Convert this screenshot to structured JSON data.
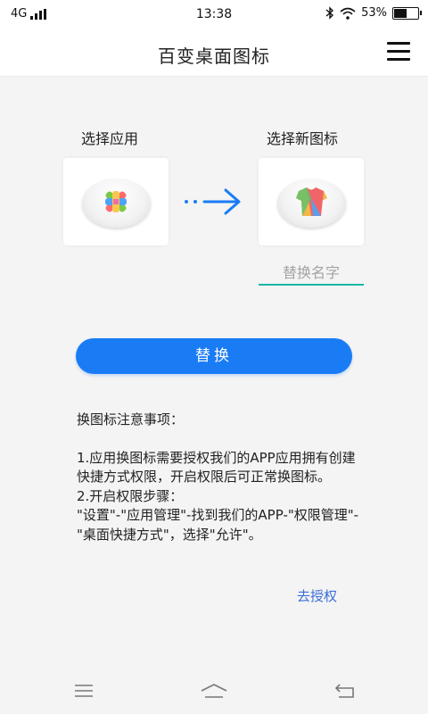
{
  "status_bar": {
    "network": "4G",
    "time": "13:38",
    "battery_percent": "53%",
    "battery_level": 0.53,
    "icons": [
      "signal-icon",
      "bluetooth-icon",
      "wifi-icon",
      "battery-icon"
    ]
  },
  "header": {
    "title": "百变桌面图标",
    "menu_icon": "menu-icon"
  },
  "select_app": {
    "label": "选择应用",
    "icon": "app-icon-placeholder"
  },
  "select_new_icon": {
    "label": "选择新图标",
    "icon": "shirt-icon"
  },
  "arrow_icon": "arrow-right-icon",
  "name_input": {
    "value": "",
    "placeholder": "替换名字"
  },
  "replace_button": {
    "label": "替换",
    "color": "#1a7cf5"
  },
  "notes": {
    "heading": "换图标注意事项：",
    "body": "1.应用换图标需要授权我们的APP应用拥有创建快捷方式权限，开启权限后可正常换图标。\n2.开启权限步骤：\n\"设置\"-\"应用管理\"-找到我们的APP-\"权限管理\"-\"桌面快捷方式\"，选择\"允许\"。"
  },
  "authorize_link": "去授权",
  "nav_bar": {
    "buttons": [
      "menu-nav-icon",
      "home-nav-icon",
      "back-nav-icon"
    ]
  }
}
